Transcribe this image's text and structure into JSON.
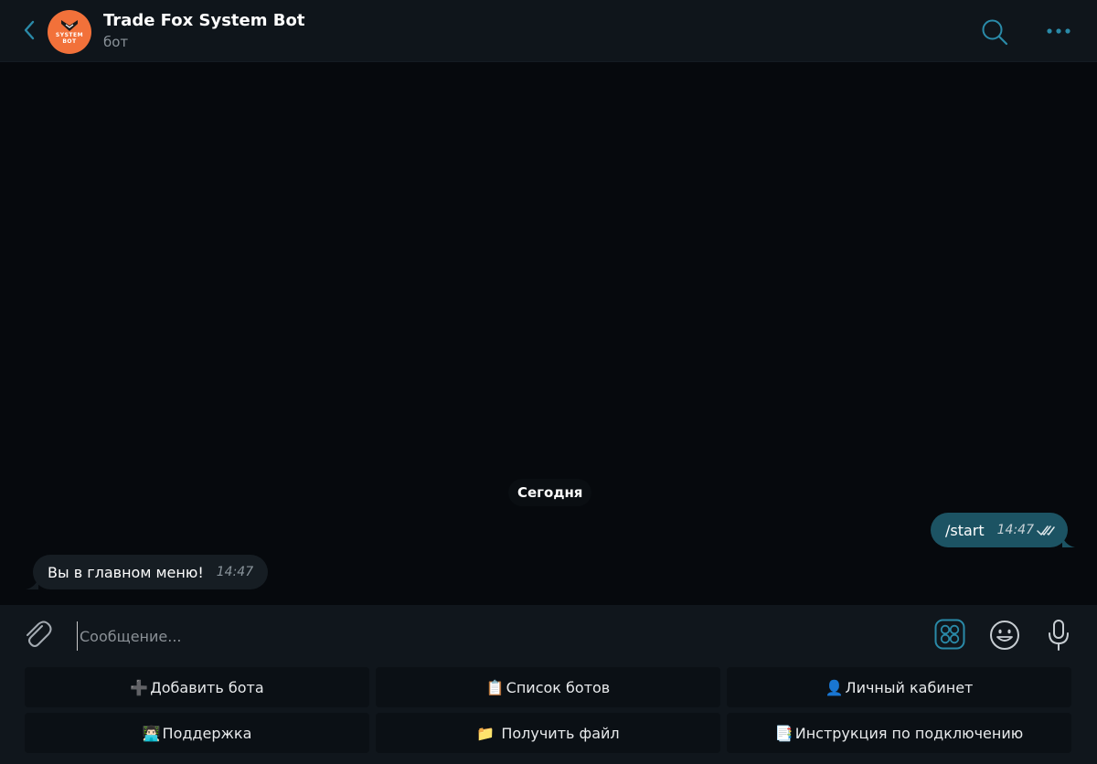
{
  "header": {
    "title": "Trade Fox System Bot",
    "subtitle": "бот",
    "avatar": {
      "line1": "SYSTEM",
      "line2": "BOT",
      "color": "#f2713a"
    }
  },
  "chat": {
    "date_separator": "Сегодня",
    "messages": [
      {
        "direction": "out",
        "text": "/start",
        "time": "14:47",
        "status": "read",
        "status_icon": "double-check-icon"
      },
      {
        "direction": "in",
        "text": "Вы в главном меню!",
        "time": "14:47"
      }
    ]
  },
  "input": {
    "placeholder": "Сообщение...",
    "value": ""
  },
  "keyboard": {
    "buttons": [
      {
        "icon": "➕",
        "label": "Добавить бота"
      },
      {
        "icon": "📋",
        "label": "Список ботов"
      },
      {
        "icon": "👤",
        "label": "Личный кабинет"
      },
      {
        "icon": "👨🏻‍💻",
        "label": "Поддержка"
      },
      {
        "icon": "📁",
        "label": " Получить файл"
      },
      {
        "icon": "📑",
        "label": "Инструкция по подключению"
      }
    ]
  },
  "colors": {
    "accent": "#2a8aa8",
    "outgoing_bubble": "#1c5363",
    "incoming_bubble": "#161d23",
    "background": "#06090d"
  }
}
